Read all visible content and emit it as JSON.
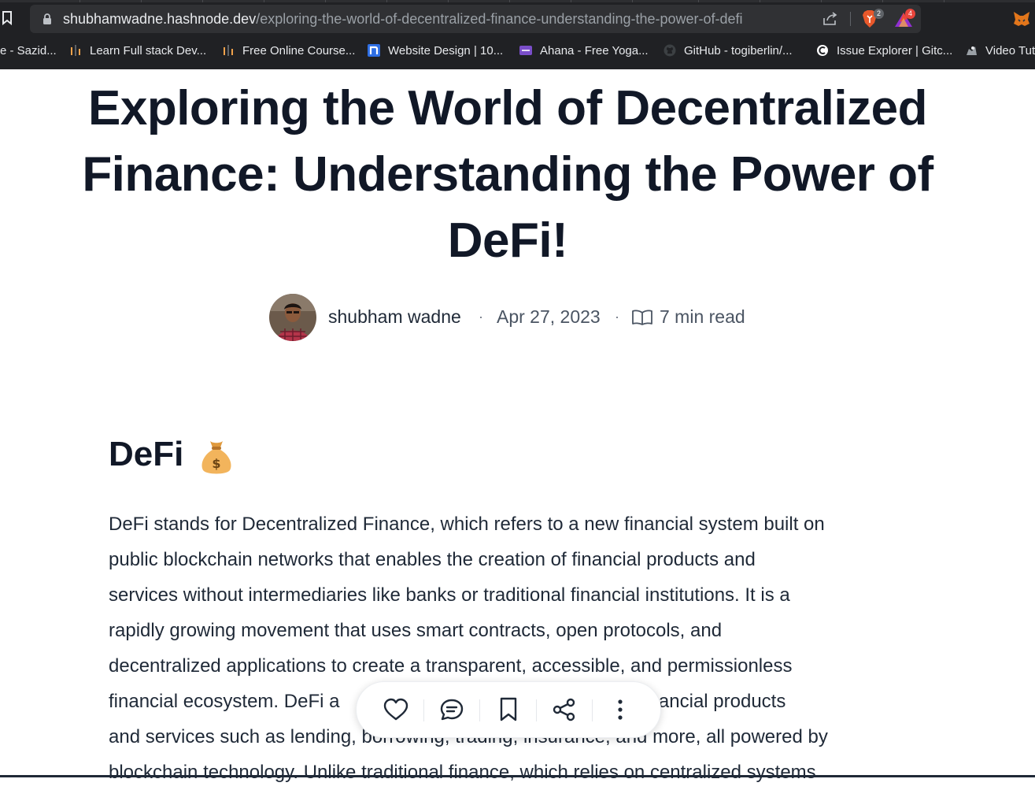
{
  "browser": {
    "url_domain": "shubhamwadne.hashnode.dev",
    "url_path": "/exploring-the-world-of-decentralized-finance-understanding-the-power-of-defi",
    "brave_badge": "2",
    "rewards_badge": "4",
    "bookmarks": [
      {
        "label": "e - Sazid...",
        "icon": "none"
      },
      {
        "label": "Learn Full stack Dev...",
        "icon": "bar-chart-favicon"
      },
      {
        "label": "Free Online Course...",
        "icon": "bar-chart-favicon"
      },
      {
        "label": "Website Design | 10...",
        "icon": "n-favicon"
      },
      {
        "label": "Ahana - Free Yoga...",
        "icon": "colorlib-favicon"
      },
      {
        "label": "GitHub - togiberlin/...",
        "icon": "github-icon"
      },
      {
        "label": "Issue Explorer | Gitc...",
        "icon": "gitcoin-icon"
      },
      {
        "label": "Video Tut",
        "icon": "video-icon"
      }
    ]
  },
  "article": {
    "title_lines": [
      "Exploring the World of Decentralized",
      "Finance: Understanding the Power of",
      "DeFi!"
    ],
    "author": "shubham wadne",
    "separator": "·",
    "date": "Apr 27, 2023",
    "read_time": "7 min read",
    "section_heading": "DeFi",
    "section_icon": "moneybag-icon",
    "paragraph_lines": [
      "DeFi stands for Decentralized Finance, which refers to a new financial system built on",
      "public blockchain networks that enables the creation of financial products and",
      "services without intermediaries like banks or traditional financial institutions. It is a",
      "rapidly growing movement that uses smart contracts, open protocols, and",
      "decentralized applications to create a transparent, accessible, and permissionless",
      "financial ecosystem. DeFi a                                              nge of financial products",
      "and services such as lending, borrowing, trading, insurance, and more, all powered by",
      "blockchain technology. Unlike traditional finance, which relies on centralized systems"
    ]
  },
  "actions": [
    "like-button",
    "comment-button",
    "bookmark-button",
    "share-button",
    "more-button"
  ],
  "colors": {
    "chrome_bg": "#202124",
    "title_text": "#111827",
    "body_text": "#1f2937"
  }
}
